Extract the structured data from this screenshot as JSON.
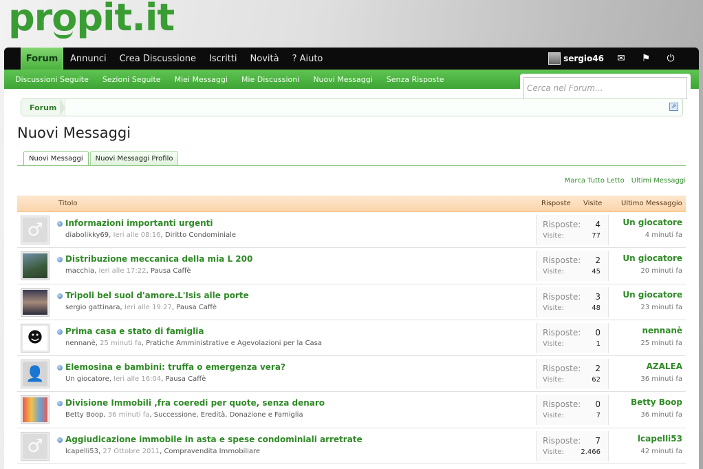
{
  "brand": {
    "logo_text": "propit.it",
    "accent": "#3a9d33"
  },
  "nav": {
    "active_tab": "Forum",
    "links": [
      "Annunci",
      "Crea Discussione",
      "Iscritti",
      "Novità",
      "? Aiuto"
    ],
    "username": "sergio46",
    "icons": [
      "envelope-icon",
      "flag-icon",
      "power-icon"
    ]
  },
  "subnav": {
    "links": [
      "Discussioni Seguite",
      "Sezioni Seguite",
      "Miei Messaggi",
      "Mie Discussioni",
      "Nuovi Messaggi",
      "Senza Risposte"
    ]
  },
  "search": {
    "placeholder": "Cerca nel Forum..."
  },
  "breadcrumb": {
    "root": "Forum"
  },
  "page": {
    "title": "Nuovi Messaggi",
    "tabs": [
      "Nuovi Messaggi",
      "Nuovi Messaggi Profilo"
    ],
    "actions": [
      "Marca Tutto Letto",
      "Ultimi Messaggi"
    ]
  },
  "list": {
    "headers": {
      "title": "Titolo",
      "replies": "Risposte",
      "views": "Visite",
      "last": "Ultimo Messaggio"
    },
    "replies_label": "Risposte:",
    "views_label": "Visite:",
    "threads": [
      {
        "title": "Informazioni importanti urgenti",
        "author": "diabolikky69",
        "when": "Ieri alle 08:16",
        "section": "Diritto Condominiale",
        "replies": "4",
        "views": "77",
        "last_user": "Un giocatore",
        "last_time": "4 minuti fa",
        "avatar": "male-silhouette"
      },
      {
        "title": "Distribuzione meccanica della mia L 200",
        "author": "macchia",
        "when": "Ieri alle 17:22",
        "section": "Pausa Caffè",
        "replies": "2",
        "views": "45",
        "last_user": "Un giocatore",
        "last_time": "20 minuti fa",
        "avatar": "photo"
      },
      {
        "title": "Tripoli bel suol d'amore.L'Isis alle porte",
        "author": "sergio gattinara",
        "when": "Ieri alle 19:27",
        "section": "Pausa Caffè",
        "replies": "3",
        "views": "48",
        "last_user": "Un giocatore",
        "last_time": "23 minuti fa",
        "avatar": "photo"
      },
      {
        "title": "Prima casa e stato di famiglia",
        "author": "nennanè",
        "when": "25 minuti fa",
        "section": "Pratiche Amministrative e Agevolazioni per la Casa",
        "replies": "0",
        "views": "1",
        "last_user": "nennanè",
        "last_time": "25 minuti fa",
        "avatar": "girl"
      },
      {
        "title": "Elemosina e bambini: truffa o emergenza vera?",
        "author": "Un giocatore",
        "when": "Ieri alle 16:04",
        "section": "Pausa Caffè",
        "replies": "2",
        "views": "62",
        "last_user": "AZALEA",
        "last_time": "36 minuti fa",
        "avatar": "blank"
      },
      {
        "title": "Divisione Immobili ,fra coeredi per quote, senza denaro",
        "author": "Betty Boop",
        "when": "36 minuti fa",
        "section": "Successione, Eredità, Donazione e Famiglia",
        "replies": "0",
        "views": "7",
        "last_user": "Betty Boop",
        "last_time": "36 minuti fa",
        "avatar": "cartoon"
      },
      {
        "title": "Aggiudicazione immobile in asta e spese condominiali arretrate",
        "author": "lcapelli53",
        "when": "27 Ottobre 2011",
        "section": "Compravendita Immobiliare",
        "replies": "7",
        "views": "2.466",
        "last_user": "lcapelli53",
        "last_time": "42 minuti fa",
        "avatar": "male-silhouette"
      }
    ]
  }
}
